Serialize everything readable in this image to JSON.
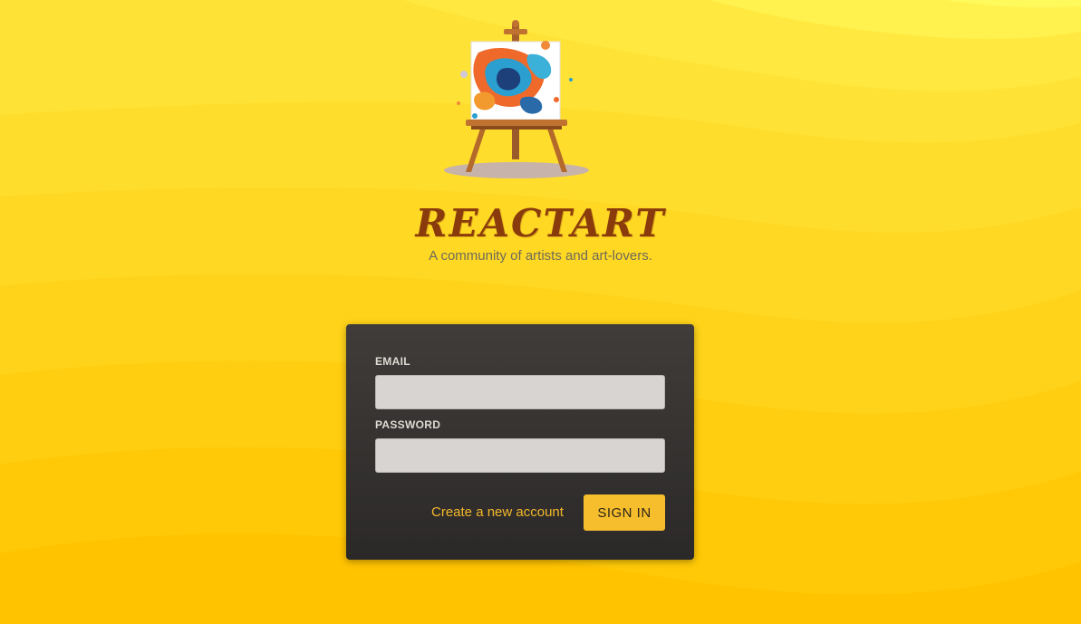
{
  "brand": {
    "title": "REACTART",
    "subtitle": "A community of artists and art-lovers.",
    "logo_icon": "easel-painting-icon"
  },
  "login": {
    "email_label": "EMAIL",
    "email_value": "",
    "password_label": "PASSWORD",
    "password_value": "",
    "create_account_label": "Create a new account",
    "sign_in_label": "SIGN IN"
  },
  "colors": {
    "background": "#ffcf1a",
    "brand_title": "#8a3b0c",
    "card": "#353230",
    "accent": "#f6bd2c",
    "link": "#f5b82a"
  }
}
